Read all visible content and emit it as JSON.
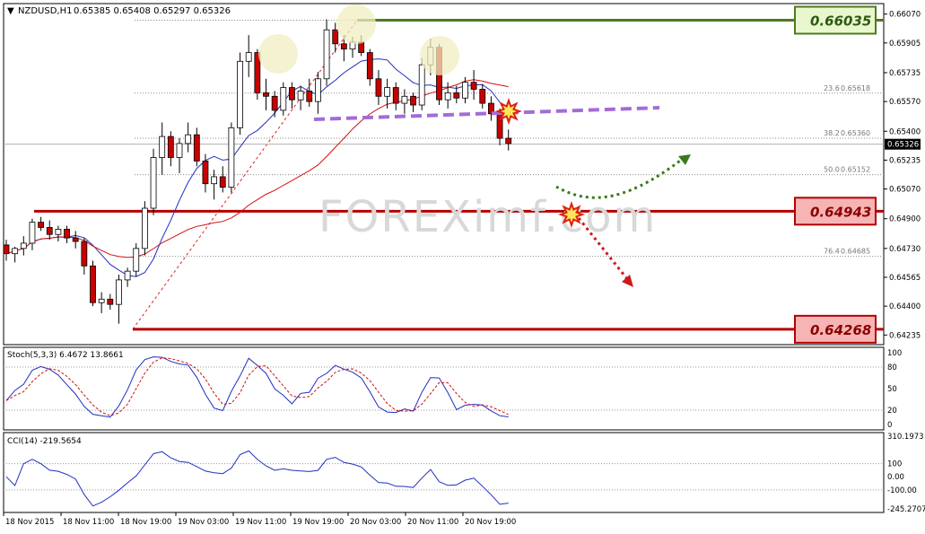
{
  "header": {
    "symbol": "NZDUSD,H1",
    "ohlc": "0.65385 0.65408 0.65297 0.65326"
  },
  "watermark": "FOREXimf.com",
  "chart_data": [
    {
      "type": "candlestick",
      "title": "NZDUSD,H1",
      "ylim": [
        0.6418,
        0.6613
      ],
      "y_ticks": [
        "0.66070",
        "0.65905",
        "0.65735",
        "0.65570",
        "0.65400",
        "0.65235",
        "0.65070",
        "0.64900",
        "0.64730",
        "0.64565",
        "0.64400",
        "0.64235"
      ],
      "x_ticks": [
        "18 Nov 2015",
        "18 Nov 11:00",
        "18 Nov 19:00",
        "19 Nov 03:00",
        "19 Nov 11:00",
        "19 Nov 19:00",
        "20 Nov 03:00",
        "20 Nov 11:00",
        "20 Nov 19:00"
      ],
      "candles": [
        [
          0.6475,
          0.6478,
          0.6466,
          0.647
        ],
        [
          0.647,
          0.6474,
          0.6465,
          0.6473
        ],
        [
          0.6473,
          0.648,
          0.6469,
          0.6476
        ],
        [
          0.6476,
          0.649,
          0.6472,
          0.6488
        ],
        [
          0.6488,
          0.6491,
          0.6483,
          0.6485
        ],
        [
          0.6485,
          0.6489,
          0.6478,
          0.6481
        ],
        [
          0.6481,
          0.6486,
          0.6477,
          0.6484
        ],
        [
          0.6484,
          0.6486,
          0.6476,
          0.6479
        ],
        [
          0.6479,
          0.6483,
          0.6473,
          0.6477
        ],
        [
          0.6477,
          0.6479,
          0.6458,
          0.6463
        ],
        [
          0.6463,
          0.6466,
          0.644,
          0.6442
        ],
        [
          0.6442,
          0.6448,
          0.6436,
          0.6444
        ],
        [
          0.6444,
          0.6447,
          0.6438,
          0.6441
        ],
        [
          0.6441,
          0.6458,
          0.643,
          0.6455
        ],
        [
          0.6455,
          0.6462,
          0.6451,
          0.646
        ],
        [
          0.646,
          0.6476,
          0.6457,
          0.6473
        ],
        [
          0.6473,
          0.65,
          0.6469,
          0.6496
        ],
        [
          0.6496,
          0.653,
          0.6492,
          0.6525
        ],
        [
          0.6525,
          0.6545,
          0.6515,
          0.6537
        ],
        [
          0.6537,
          0.654,
          0.652,
          0.6525
        ],
        [
          0.6525,
          0.6536,
          0.6516,
          0.6533
        ],
        [
          0.6533,
          0.6545,
          0.6528,
          0.6538
        ],
        [
          0.6538,
          0.6542,
          0.652,
          0.6523
        ],
        [
          0.6523,
          0.6527,
          0.6505,
          0.651
        ],
        [
          0.651,
          0.6518,
          0.6501,
          0.6514
        ],
        [
          0.6514,
          0.652,
          0.6505,
          0.6508
        ],
        [
          0.6508,
          0.6545,
          0.6505,
          0.6542
        ],
        [
          0.6542,
          0.6585,
          0.6538,
          0.658
        ],
        [
          0.658,
          0.6595,
          0.6571,
          0.6585
        ],
        [
          0.6585,
          0.6587,
          0.6558,
          0.6562
        ],
        [
          0.6562,
          0.657,
          0.6552,
          0.656
        ],
        [
          0.656,
          0.6563,
          0.6548,
          0.6552
        ],
        [
          0.6552,
          0.6568,
          0.6549,
          0.6565
        ],
        [
          0.6565,
          0.6568,
          0.6553,
          0.6558
        ],
        [
          0.6558,
          0.6566,
          0.6552,
          0.6563
        ],
        [
          0.6563,
          0.657,
          0.6554,
          0.6557
        ],
        [
          0.6557,
          0.6574,
          0.655,
          0.657
        ],
        [
          0.657,
          0.6604,
          0.6566,
          0.6598
        ],
        [
          0.6598,
          0.6602,
          0.6585,
          0.659
        ],
        [
          0.659,
          0.6595,
          0.658,
          0.6587
        ],
        [
          0.6587,
          0.6594,
          0.6582,
          0.6591
        ],
        [
          0.6591,
          0.6595,
          0.6583,
          0.6585
        ],
        [
          0.6585,
          0.6587,
          0.6566,
          0.657
        ],
        [
          0.657,
          0.6575,
          0.6555,
          0.656
        ],
        [
          0.656,
          0.657,
          0.6553,
          0.6565
        ],
        [
          0.6565,
          0.6568,
          0.6552,
          0.6556
        ],
        [
          0.6556,
          0.6564,
          0.655,
          0.656
        ],
        [
          0.656,
          0.6562,
          0.6551,
          0.6555
        ],
        [
          0.6555,
          0.6582,
          0.6552,
          0.6578
        ],
        [
          0.6578,
          0.6593,
          0.6572,
          0.6588
        ],
        [
          0.6588,
          0.659,
          0.6555,
          0.6558
        ],
        [
          0.6558,
          0.6568,
          0.6553,
          0.6562
        ],
        [
          0.6562,
          0.6566,
          0.6556,
          0.6559
        ],
        [
          0.6559,
          0.6571,
          0.6556,
          0.6568
        ],
        [
          0.6568,
          0.6575,
          0.6558,
          0.6564
        ],
        [
          0.6564,
          0.6567,
          0.6553,
          0.6556
        ],
        [
          0.6556,
          0.656,
          0.6546,
          0.655
        ],
        [
          0.655,
          0.6553,
          0.6532,
          0.6536
        ],
        [
          0.6536,
          0.6541,
          0.6529,
          0.6533
        ]
      ],
      "fib_levels": [
        {
          "label": "23.6",
          "value": "0.65618"
        },
        {
          "label": "38.2",
          "value": "0.65360"
        },
        {
          "label": "50.0",
          "value": "0.65152"
        },
        {
          "label": "76.4",
          "value": "0.64685"
        }
      ],
      "levels": [
        {
          "value": "0.66035",
          "kind": "resistance",
          "color": "#4f7a1e"
        },
        {
          "value": "0.64943",
          "kind": "support",
          "color": "#b40000"
        },
        {
          "value": "0.64268",
          "kind": "support",
          "color": "#b40000"
        }
      ],
      "current_price": "0.65326",
      "colors": {
        "bull": "#ffffff",
        "bear": "#c80000",
        "ma_fast": "#1f2fbf",
        "ma_slow": "#d01010",
        "green": "#3b7a1a",
        "red": "#d01818",
        "purple": "#a46bd8"
      }
    },
    {
      "type": "line",
      "title": "Stoch(5,3,3) 6.4672 13.8661",
      "ylim": [
        0,
        100
      ],
      "y_ticks": [
        "100",
        "80",
        "50",
        "20",
        "0"
      ],
      "series": []
    },
    {
      "type": "line",
      "title": "CCI(14) -219.5654",
      "ylim": [
        -245.2707,
        310.1973
      ],
      "y_ticks": [
        "310.1973",
        "100",
        "0.00",
        "-100.00",
        "-245.2707"
      ],
      "series": []
    }
  ]
}
